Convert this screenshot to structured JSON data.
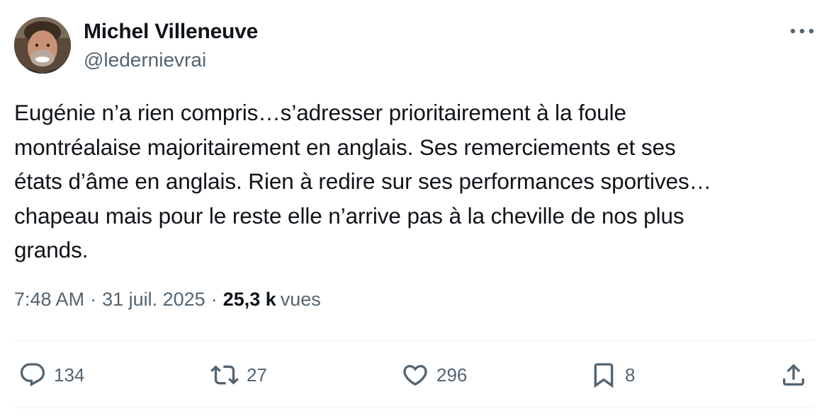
{
  "author": {
    "display_name": "Michel Villeneuve",
    "handle": "@ledernievrai"
  },
  "tweet": {
    "lines": [
      "Eugénie n’a rien compris…s’adresser prioritairement à la foule",
      "montréalaise majoritairement en anglais.  Ses remerciements et ses",
      "états d’âme en anglais.  Rien à redire sur ses performances sportives…",
      "chapeau mais pour le reste elle n’arrive pas à la cheville de nos plus",
      "grands."
    ]
  },
  "meta": {
    "time": "7:48 AM",
    "separator": "·",
    "date": "31 juil. 2025",
    "views_count": "25,3 k",
    "views_label": "vues"
  },
  "actions": {
    "replies": "134",
    "reposts": "27",
    "likes": "296",
    "bookmarks": "8"
  },
  "icons": {
    "more": "more-horizontal-icon",
    "reply": "reply-icon",
    "repost": "repost-icon",
    "like": "heart-icon",
    "bookmark": "bookmark-icon",
    "share": "share-icon"
  },
  "colors": {
    "text_primary": "#0f1419",
    "text_secondary": "#536471",
    "divider": "#eff3f4"
  }
}
